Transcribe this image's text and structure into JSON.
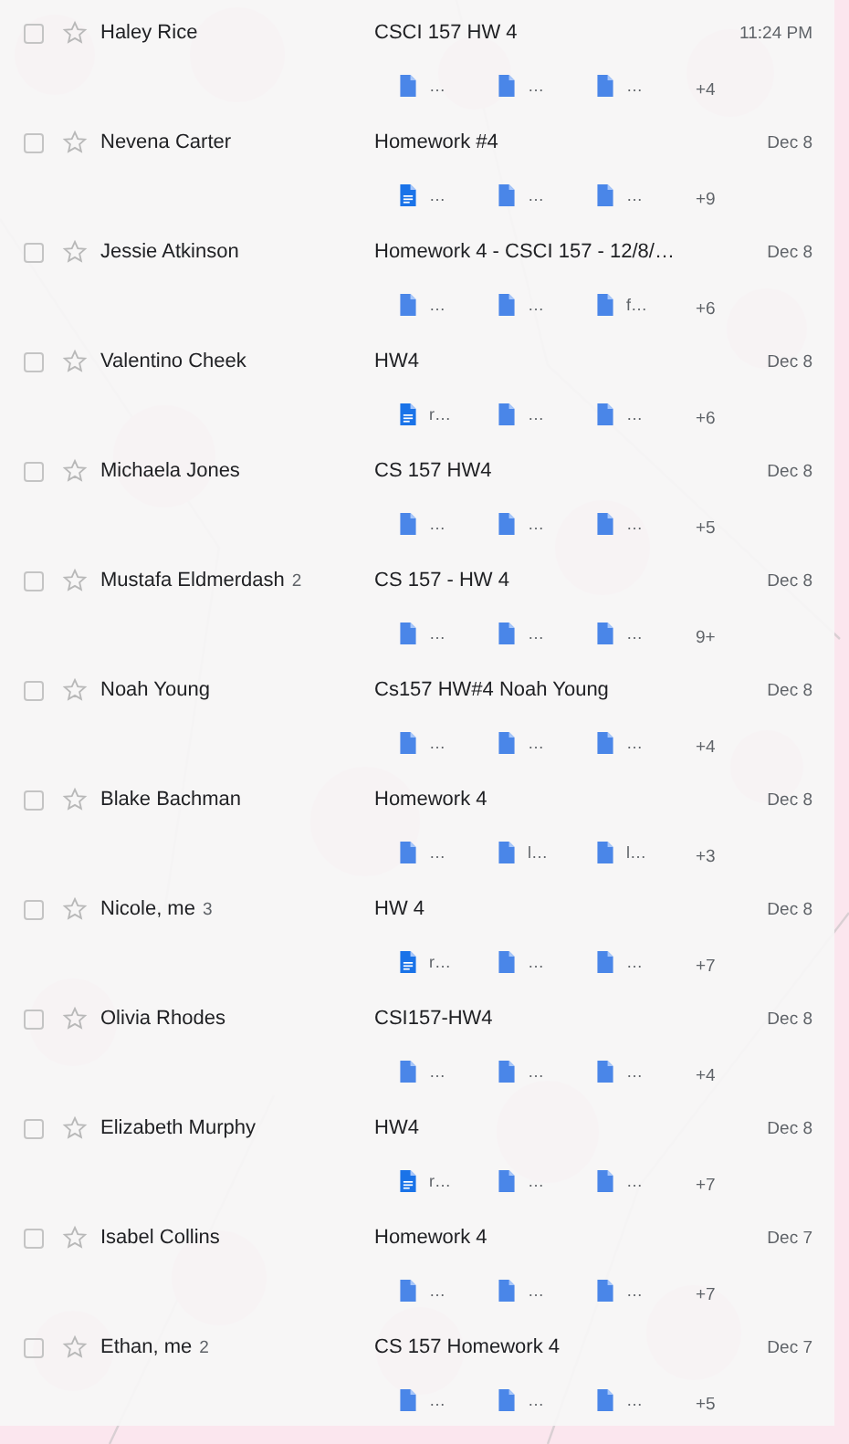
{
  "messages": [
    {
      "sender": "Haley Rice",
      "subject": "CSCI 157 HW 4",
      "date": "11:24 PM",
      "checked": false,
      "starred": false,
      "attachments": [
        {
          "kind": "file",
          "name": "…"
        },
        {
          "kind": "file",
          "name": "…"
        },
        {
          "kind": "file",
          "name": "…"
        }
      ],
      "more": "+4"
    },
    {
      "sender": "Nevena Carter",
      "subject": "Homework #4",
      "date": "Dec 8",
      "checked": false,
      "starred": false,
      "attachments": [
        {
          "kind": "doc",
          "name": "…"
        },
        {
          "kind": "file",
          "name": "…"
        },
        {
          "kind": "file",
          "name": "…"
        }
      ],
      "more": "+9"
    },
    {
      "sender": "Jessie Atkinson",
      "subject": "Homework 4 - CSCI 157 - 12/8/…",
      "date": "Dec 8",
      "checked": false,
      "starred": false,
      "attachments": [
        {
          "kind": "file",
          "name": "…"
        },
        {
          "kind": "file",
          "name": "…"
        },
        {
          "kind": "file",
          "name": "f…"
        }
      ],
      "more": "+6"
    },
    {
      "sender": "Valentino Cheek",
      "subject": "HW4",
      "date": "Dec 8",
      "checked": false,
      "starred": false,
      "attachments": [
        {
          "kind": "doc",
          "name": "r…"
        },
        {
          "kind": "file",
          "name": "…"
        },
        {
          "kind": "file",
          "name": "…"
        }
      ],
      "more": "+6"
    },
    {
      "sender": "Michaela Jones",
      "subject": "CS 157 HW4",
      "date": "Dec 8",
      "checked": false,
      "starred": false,
      "attachments": [
        {
          "kind": "file",
          "name": "…"
        },
        {
          "kind": "file",
          "name": "…"
        },
        {
          "kind": "file",
          "name": "…"
        }
      ],
      "more": "+5"
    },
    {
      "sender": "Mustafa Eldmerdash",
      "count": "2",
      "subject": "CS 157 - HW 4",
      "date": "Dec 8",
      "checked": false,
      "starred": false,
      "attachments": [
        {
          "kind": "file",
          "name": "…"
        },
        {
          "kind": "file",
          "name": "…"
        },
        {
          "kind": "file",
          "name": "…"
        }
      ],
      "more": "9+"
    },
    {
      "sender": "Noah Young",
      "subject": "Cs157 HW#4 Noah Young",
      "date": "Dec 8",
      "checked": false,
      "starred": false,
      "attachments": [
        {
          "kind": "file",
          "name": "…"
        },
        {
          "kind": "file",
          "name": "…"
        },
        {
          "kind": "file",
          "name": "…"
        }
      ],
      "more": "+4"
    },
    {
      "sender": "Blake Bachman",
      "subject": "Homework 4",
      "date": "Dec 8",
      "checked": false,
      "starred": false,
      "attachments": [
        {
          "kind": "file",
          "name": "…"
        },
        {
          "kind": "file",
          "name": "l…"
        },
        {
          "kind": "file",
          "name": "l…"
        }
      ],
      "more": "+3"
    },
    {
      "sender": "Nicole, me",
      "count": "3",
      "subject": "HW 4",
      "date": "Dec 8",
      "checked": false,
      "starred": false,
      "attachments": [
        {
          "kind": "doc",
          "name": "r…"
        },
        {
          "kind": "file",
          "name": "…"
        },
        {
          "kind": "file",
          "name": "…"
        }
      ],
      "more": "+7"
    },
    {
      "sender": "Olivia Rhodes",
      "subject": "CSI157-HW4",
      "date": "Dec 8",
      "checked": false,
      "starred": false,
      "attachments": [
        {
          "kind": "file",
          "name": "…"
        },
        {
          "kind": "file",
          "name": "…"
        },
        {
          "kind": "file",
          "name": "…"
        }
      ],
      "more": "+4"
    },
    {
      "sender": "Elizabeth Murphy",
      "subject": "HW4",
      "date": "Dec 8",
      "checked": false,
      "starred": false,
      "attachments": [
        {
          "kind": "doc",
          "name": "r…"
        },
        {
          "kind": "file",
          "name": "…"
        },
        {
          "kind": "file",
          "name": "…"
        }
      ],
      "more": "+7"
    },
    {
      "sender": "Isabel Collins",
      "subject": "Homework 4",
      "date": "Dec 7",
      "checked": false,
      "starred": false,
      "attachments": [
        {
          "kind": "file",
          "name": "…"
        },
        {
          "kind": "file",
          "name": "…"
        },
        {
          "kind": "file",
          "name": "…"
        }
      ],
      "more": "+7"
    },
    {
      "sender": "Ethan, me",
      "count": "2",
      "subject": "CS 157 Homework 4",
      "date": "Dec 7",
      "checked": false,
      "starred": false,
      "attachments": [
        {
          "kind": "file",
          "name": "…"
        },
        {
          "kind": "file",
          "name": "…"
        },
        {
          "kind": "file",
          "name": "…"
        }
      ],
      "more": "+5"
    }
  ]
}
